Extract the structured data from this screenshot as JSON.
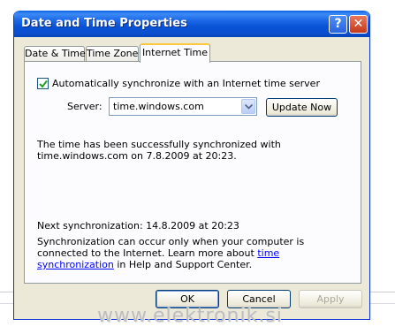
{
  "window": {
    "title": "Date and Time Properties",
    "help_label": "?",
    "close_label": "✕"
  },
  "tabs": [
    {
      "label": "Date & Time",
      "selected": false
    },
    {
      "label": "Time Zone",
      "selected": false
    },
    {
      "label": "Internet Time",
      "selected": true
    }
  ],
  "auto_sync": {
    "checked": true,
    "label": "Automatically synchronize with an Internet time server"
  },
  "server": {
    "label": "Server:",
    "value": "time.windows.com"
  },
  "update_button": "Update Now",
  "status_message": "The time has been successfully synchronized with time.windows.com on 7.8.2009 at 20:23.",
  "next_sync": "Next synchronization: 14.8.2009 at 20:23",
  "note": {
    "before_link": "Synchronization can occur only when your computer is connected to the Internet.  Learn more about ",
    "link": "time synchronization",
    "after_link": " in Help and Support Center."
  },
  "buttons": {
    "ok": "OK",
    "cancel": "Cancel",
    "apply": "Apply"
  },
  "watermark": "www.elektronik.si",
  "colors": {
    "titlebar": "#0a55d6",
    "dialog_bg": "#ece9d8",
    "tab_highlight": "#ffc83c",
    "link": "#0000ff"
  }
}
